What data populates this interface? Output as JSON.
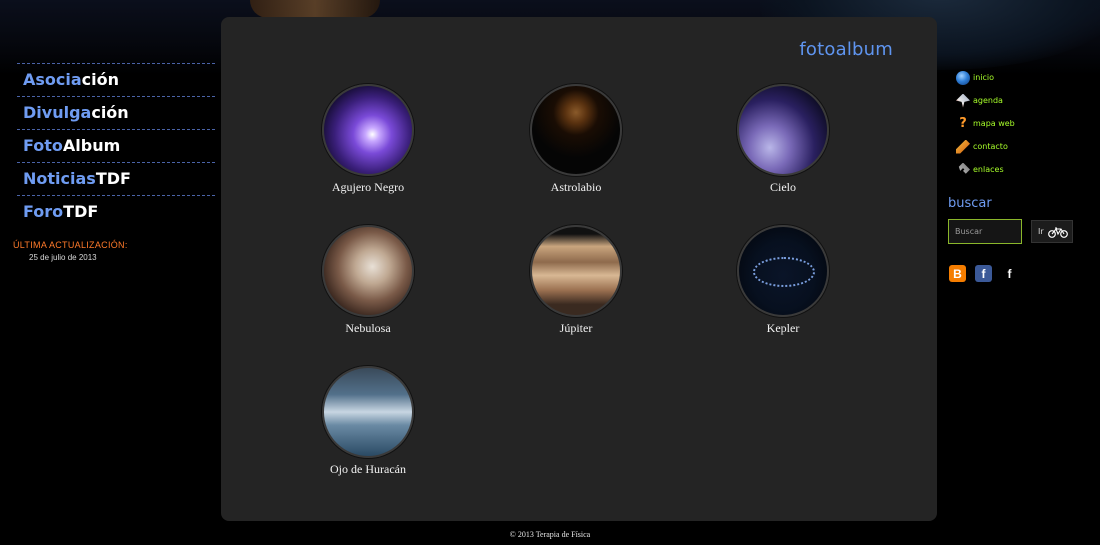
{
  "header": {
    "album_title": "fotoalbum"
  },
  "left_nav": {
    "items": [
      {
        "highlight": "Asocia",
        "rest": "ción"
      },
      {
        "highlight": "Divulga",
        "rest": "ción"
      },
      {
        "highlight": "Foto",
        "rest": "Album"
      },
      {
        "highlight": "Noticias",
        "rest": "TDF"
      },
      {
        "highlight": "Foro",
        "rest": "TDF"
      }
    ],
    "update_label": "ÚLTIMA ACTUALIZACIÓN:",
    "update_date": "25 de julio de 2013"
  },
  "gallery": {
    "items": [
      {
        "caption": "Agujero Negro"
      },
      {
        "caption": "Astrolabio"
      },
      {
        "caption": "Cielo"
      },
      {
        "caption": "Nebulosa"
      },
      {
        "caption": "Júpiter"
      },
      {
        "caption": "Kepler"
      },
      {
        "caption": "Ojo de Huracán"
      }
    ]
  },
  "right_nav": {
    "items": [
      {
        "label": "inicio",
        "icon": "globe-icon"
      },
      {
        "label": "agenda",
        "icon": "rocket-icon"
      },
      {
        "label": "mapa web",
        "icon": "question-icon"
      },
      {
        "label": "contacto",
        "icon": "pencil-icon"
      },
      {
        "label": "enlaces",
        "icon": "link-icon"
      }
    ]
  },
  "search": {
    "title": "buscar",
    "placeholder": "Buscar",
    "button_label": "Ir"
  },
  "social": {
    "blogger_glyph": "B",
    "facebook_glyph": "f",
    "facebook2_glyph": "f"
  },
  "footer": {
    "copyright": "© 2013 Terapia de Física"
  },
  "colors": {
    "accent_blue": "#6f9cf2",
    "link_green": "#a8ff2a",
    "update_orange": "#ff7a2a",
    "panel": "#242424"
  }
}
